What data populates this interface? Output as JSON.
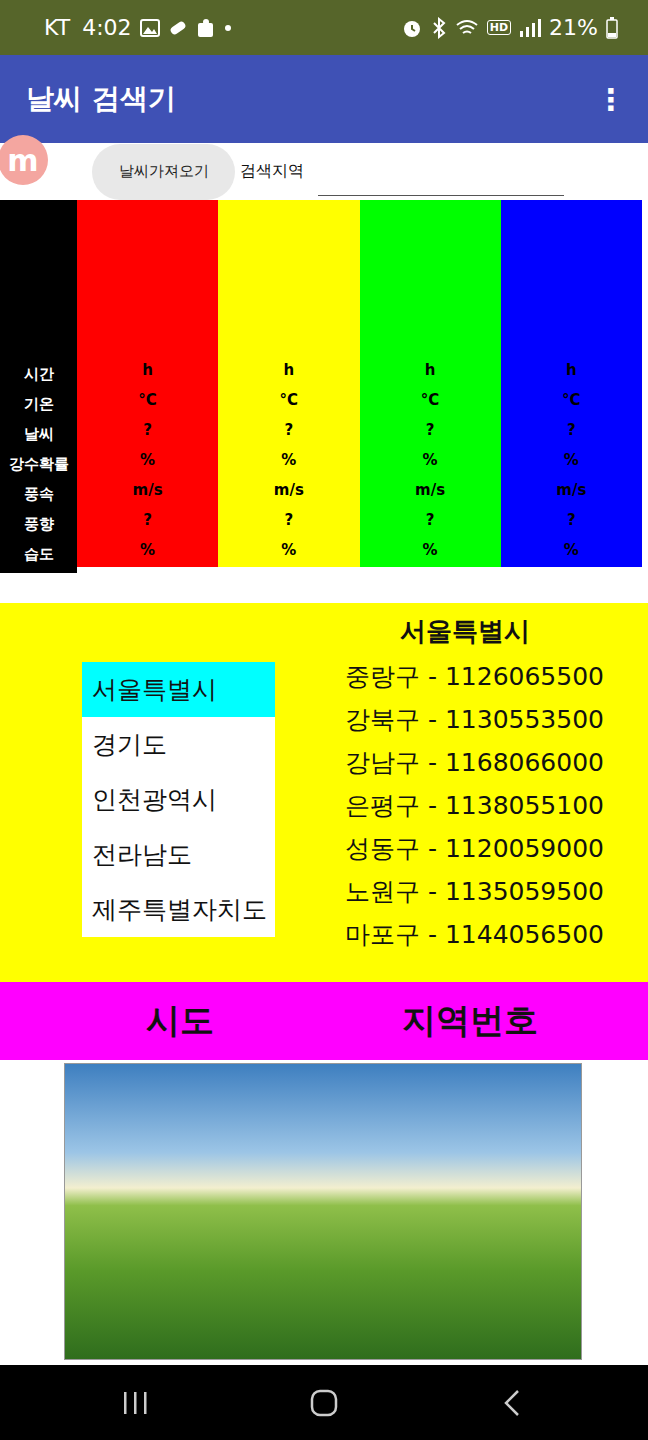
{
  "status_bar": {
    "carrier": "KT",
    "time": "4:02",
    "network_badge": "HD",
    "battery": "21%"
  },
  "app_bar": {
    "title": "날씨 검색기",
    "menu": "⋮"
  },
  "logo": {
    "letter": "m"
  },
  "fetch_button": "날씨가져오기",
  "search": {
    "label": "검색지역",
    "value": ""
  },
  "weather_table": {
    "row_labels": [
      "시간",
      "기온",
      "날씨",
      "강수확률",
      "풍속",
      "풍향",
      "습도"
    ],
    "columns": [
      {
        "color": "#ff0000",
        "values": [
          "h",
          "°C",
          "?",
          "%",
          "m/s",
          "?",
          "%"
        ]
      },
      {
        "color": "#ffff00",
        "values": [
          "h",
          "°C",
          "?",
          "%",
          "m/s",
          "?",
          "%"
        ]
      },
      {
        "color": "#00ff00",
        "values": [
          "h",
          "°C",
          "?",
          "%",
          "m/s",
          "?",
          "%"
        ]
      },
      {
        "color": "#0000ff",
        "values": [
          "h",
          "°C",
          "?",
          "%",
          "m/s",
          "?",
          "%"
        ]
      }
    ]
  },
  "regions": {
    "provinces": [
      {
        "name": "서울특별시",
        "selected": true
      },
      {
        "name": "경기도",
        "selected": false
      },
      {
        "name": "인천광역시",
        "selected": false
      },
      {
        "name": "전라남도",
        "selected": false
      },
      {
        "name": "제주특별자치도",
        "selected": false
      }
    ],
    "heading": "서울특별시",
    "districts": [
      "중랑구 - 1126065500",
      "강북구 - 1130553500",
      "강남구 - 1168066000",
      "은평구 - 1138055100",
      "성동구 - 1120059000",
      "노원구 - 1135059500",
      "마포구 - 1144056500"
    ]
  },
  "footer_headers": [
    "시도",
    "지역번호"
  ]
}
